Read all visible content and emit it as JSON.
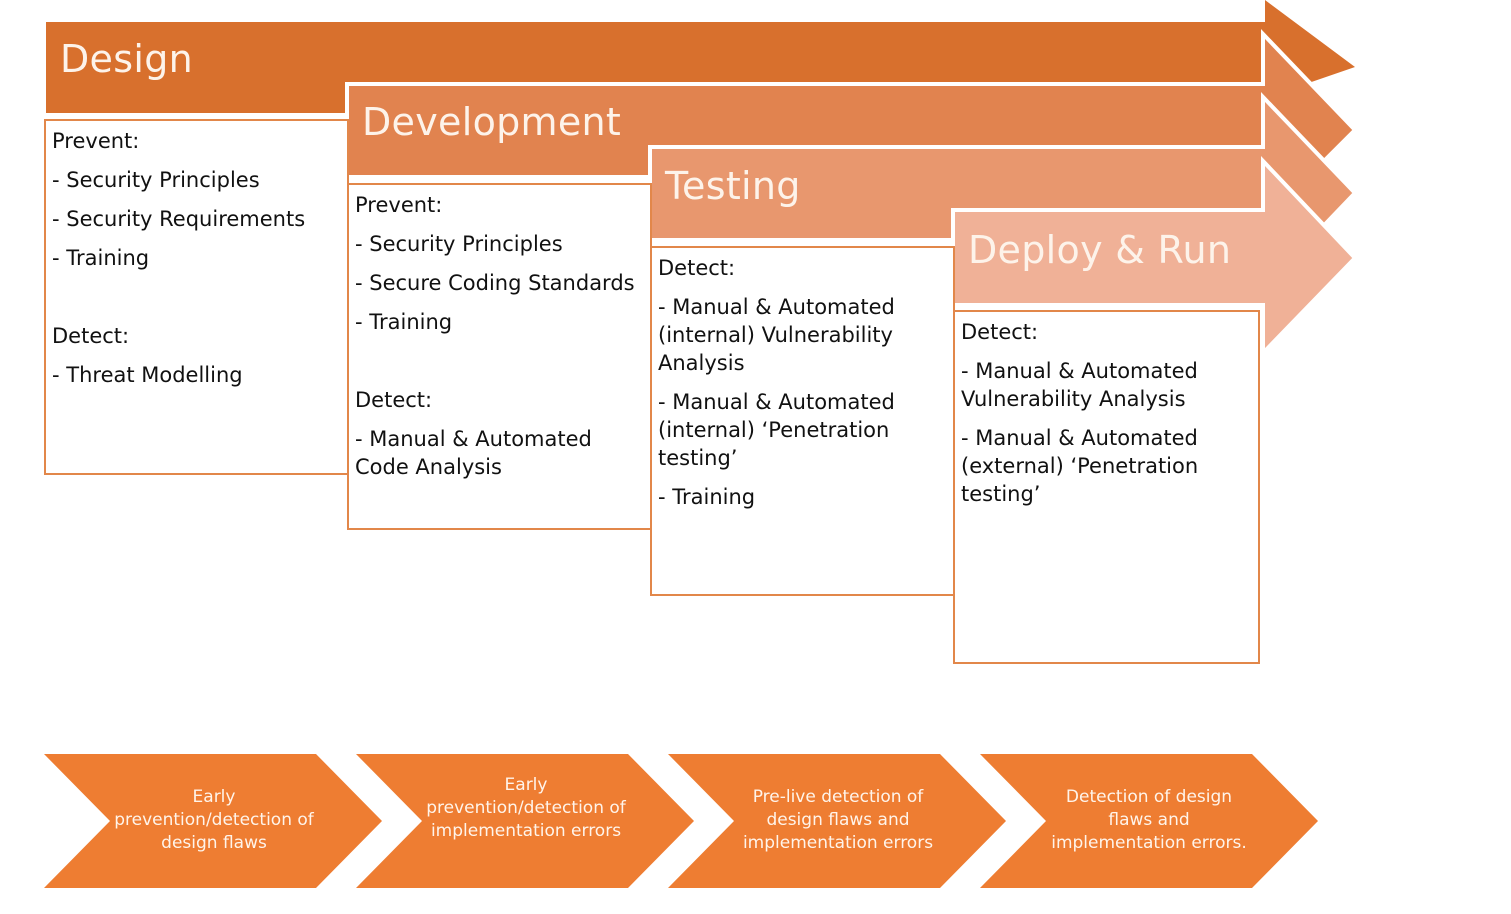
{
  "colors": {
    "design": "#d8702d",
    "development": "#e1834f",
    "testing": "#e8976e",
    "deploy": "#f0b197",
    "box_border": "#e2874a",
    "chevron": "#ee7d32",
    "title_text": "#fdf3ea"
  },
  "stages": [
    {
      "title": "Design",
      "sections": [
        {
          "heading": "Prevent:",
          "items": [
            "- Security Principles",
            "- Security Requirements",
            "- Training"
          ]
        },
        {
          "heading": "Detect:",
          "items": [
            "- Threat Modelling"
          ]
        }
      ]
    },
    {
      "title": "Development",
      "sections": [
        {
          "heading": "Prevent:",
          "items": [
            "- Security Principles",
            "- Secure Coding Standards",
            "- Training"
          ]
        },
        {
          "heading": "Detect:",
          "items": [
            "- Manual & Automated Code Analysis"
          ]
        }
      ]
    },
    {
      "title": "Testing",
      "sections": [
        {
          "heading": "Detect:",
          "items": [
            "- Manual & Automated (internal) Vulnerability Analysis",
            "- Manual & Automated (internal) ‘Penetration testing’",
            "- Training"
          ]
        }
      ]
    },
    {
      "title": "Deploy & Run",
      "sections": [
        {
          "heading": "Detect:",
          "items": [
            "- Manual & Automated Vulnerability Analysis",
            "- Manual & Automated (external) ‘Penetration testing’"
          ]
        }
      ]
    }
  ],
  "outcomes": [
    "Early prevention/detection of design flaws",
    "Early prevention/detection of implementation errors",
    "Pre-live detection of design flaws and implementation errors",
    "Detection of design flaws and implementation errors."
  ]
}
